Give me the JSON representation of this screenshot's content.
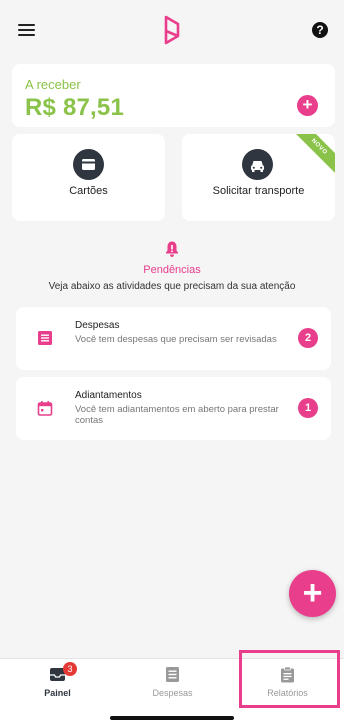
{
  "balance": {
    "label": "A receber",
    "value": "R$ 87,51"
  },
  "tiles": [
    {
      "label": "Cartões"
    },
    {
      "label": "Solicitar transporte",
      "ribbon": "NOVO"
    }
  ],
  "pendencias": {
    "title": "Pendências",
    "subtitle": "Veja abaixo as atividades que precisam da sua atenção",
    "items": [
      {
        "title": "Despesas",
        "description": "Você tem despesas que precisam ser revisadas",
        "count": "2",
        "icon": "receipt-icon"
      },
      {
        "title": "Adiantamentos",
        "description": "Você tem adiantamentos em aberto para prestar contas",
        "count": "1",
        "icon": "calendar-icon"
      }
    ]
  },
  "fab": {
    "symbol": "+"
  },
  "tabbar": {
    "items": [
      {
        "label": "Painel",
        "badge": "3",
        "active": true,
        "icon": "inbox-icon"
      },
      {
        "label": "Despesas",
        "active": false,
        "icon": "document-icon"
      },
      {
        "label": "Relatórios",
        "active": false,
        "icon": "clipboard-icon"
      }
    ]
  },
  "colors": {
    "accent": "#e83e8c",
    "green": "#8bc34a",
    "dark": "#2f3640"
  }
}
